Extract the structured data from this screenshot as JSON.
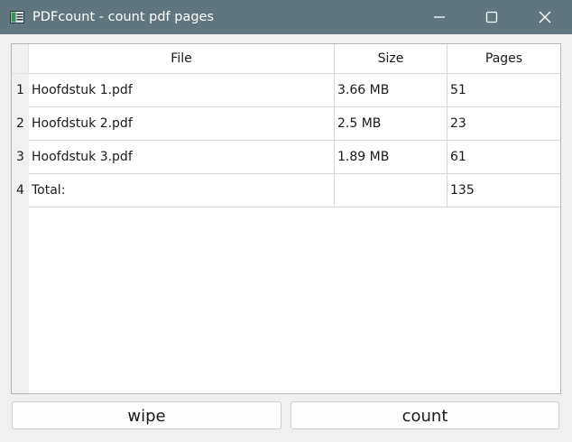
{
  "window": {
    "title": "PDFcount - count pdf pages",
    "titlebar_color": "#61757f"
  },
  "table": {
    "headers": [
      "File",
      "Size",
      "Pages"
    ],
    "row_numbers": [
      "1",
      "2",
      "3",
      "4"
    ],
    "rows": [
      {
        "file": "Hoofdstuk 1.pdf",
        "size": "3.66 MB",
        "pages": "51"
      },
      {
        "file": "Hoofdstuk 2.pdf",
        "size": "2.5 MB",
        "pages": "23"
      },
      {
        "file": "Hoofdstuk 3.pdf",
        "size": "1.89 MB",
        "pages": "61"
      },
      {
        "file": "Total:",
        "size": "",
        "pages": "135"
      }
    ]
  },
  "buttons": {
    "wipe_label": "wipe",
    "count_label": "count"
  },
  "icons": {
    "app": "pdf-app-icon",
    "minimize": "minimize-icon",
    "maximize": "maximize-icon",
    "close": "close-icon"
  }
}
